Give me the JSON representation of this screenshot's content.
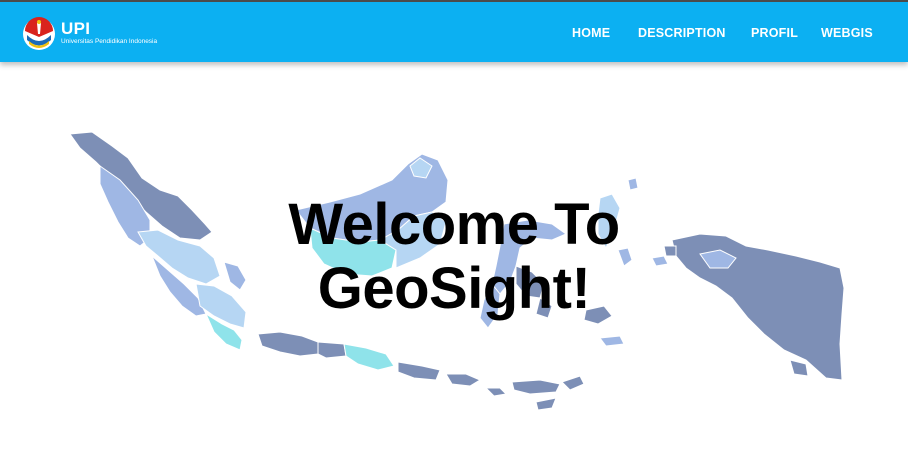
{
  "brand": {
    "title": "UPI",
    "subtitle": "Universitas Pendidikan Indonesia",
    "logo_icon": "upi-logo-icon"
  },
  "nav": {
    "home": "HOME",
    "description": "DESCRIPTION",
    "profil": "PROFIL",
    "webgis": "WEBGIS"
  },
  "hero": {
    "line1": "Welcome To",
    "line2": "GeoSight!",
    "background": "indonesia-map-illustration"
  },
  "colors": {
    "navbar": "#0cb0f2",
    "nav_text": "#ffffff",
    "headline": "#000000",
    "map_dark": "#7d8fb6",
    "map_mid": "#9fb7e4",
    "map_light": "#b6d6f3",
    "map_cyan": "#8fe3ea"
  }
}
